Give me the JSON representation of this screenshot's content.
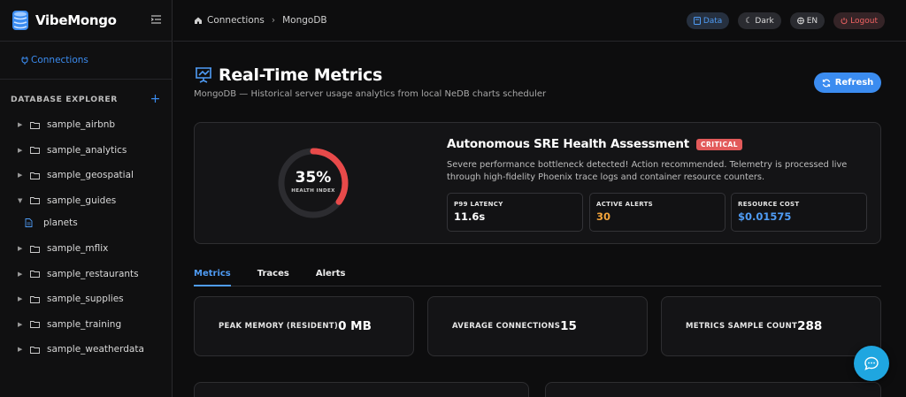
{
  "brand": {
    "name": "VibeMongo"
  },
  "sidebar": {
    "connections_label": "Connections",
    "explorer_title": "DATABASE EXPLORER",
    "databases": [
      {
        "name": "sample_airbnb",
        "expanded": false
      },
      {
        "name": "sample_analytics",
        "expanded": false
      },
      {
        "name": "sample_geospatial",
        "expanded": false
      },
      {
        "name": "sample_guides",
        "expanded": true,
        "collections": [
          "planets"
        ]
      },
      {
        "name": "sample_mflix",
        "expanded": false
      },
      {
        "name": "sample_restaurants",
        "expanded": false
      },
      {
        "name": "sample_supplies",
        "expanded": false
      },
      {
        "name": "sample_training",
        "expanded": false
      },
      {
        "name": "sample_weatherdata",
        "expanded": false
      }
    ]
  },
  "breadcrumb": {
    "root": "Connections",
    "current": "MongoDB"
  },
  "topbar": {
    "data": "Data",
    "theme": "Dark",
    "lang": "EN",
    "logout": "Logout"
  },
  "page": {
    "title": "Real-Time Metrics",
    "subtitle": "MongoDB — Historical server usage analytics from local NeDB charts scheduler",
    "refresh": "Refresh"
  },
  "health": {
    "percent": 35,
    "percent_label": "35%",
    "index_label": "HEALTH INDEX",
    "title": "Autonomous SRE Health Assessment",
    "badge": "CRITICAL",
    "description": "Severe performance bottleneck detected! Action recommended. Telemetry is processed live through high-fidelity Phoenix trace logs and container resource counters.",
    "kpis": [
      {
        "label": "P99 LATENCY",
        "value": "11.6s"
      },
      {
        "label": "ACTIVE ALERTS",
        "value": "30"
      },
      {
        "label": "RESOURCE COST",
        "value": "$0.01575"
      }
    ]
  },
  "tabs": [
    "Metrics",
    "Traces",
    "Alerts"
  ],
  "stats": [
    {
      "label": "PEAK MEMORY (RESIDENT)",
      "value": "0 MB"
    },
    {
      "label": "AVERAGE CONNECTIONS",
      "value": "15"
    },
    {
      "label": "METRICS SAMPLE COUNT",
      "value": "288"
    }
  ],
  "colors": {
    "accent": "#3b8cf0",
    "critical": "#e25a5a",
    "warning": "#f2a33a"
  }
}
